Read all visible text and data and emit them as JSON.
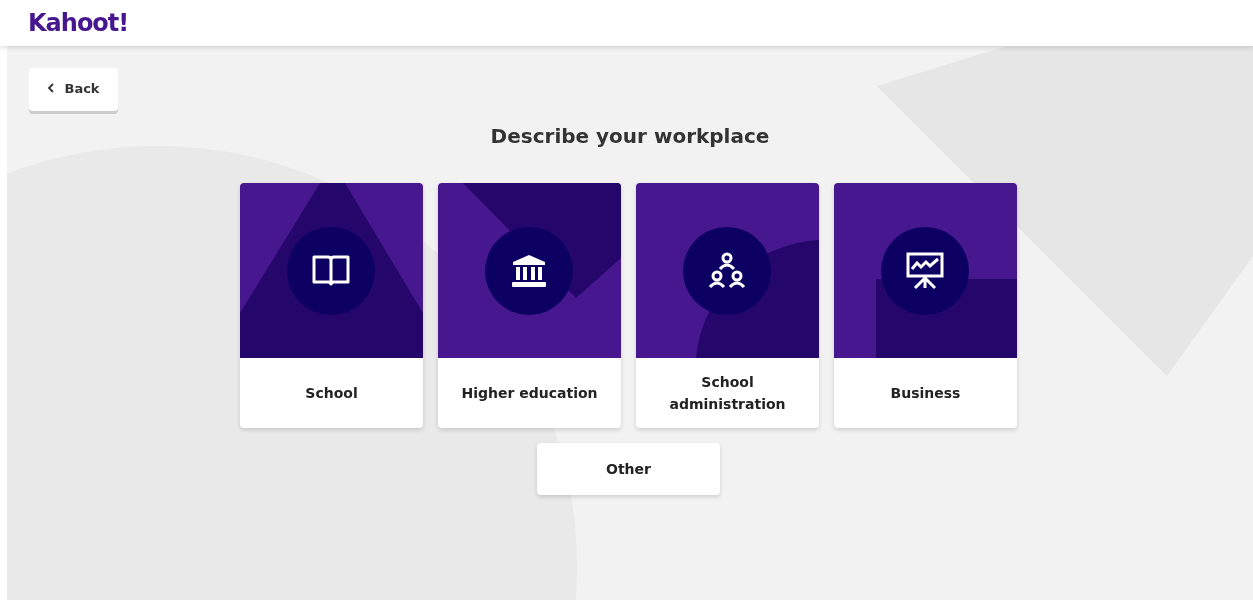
{
  "header": {
    "logo": "Kahoot!"
  },
  "back_button": {
    "label": "Back"
  },
  "title": "Describe your workplace",
  "options": [
    {
      "label": "School",
      "kind": "school"
    },
    {
      "label": "Higher education",
      "kind": "higher"
    },
    {
      "label": "School administration",
      "kind": "admin"
    },
    {
      "label": "Business",
      "kind": "business"
    }
  ],
  "other_button": {
    "label": "Other"
  }
}
